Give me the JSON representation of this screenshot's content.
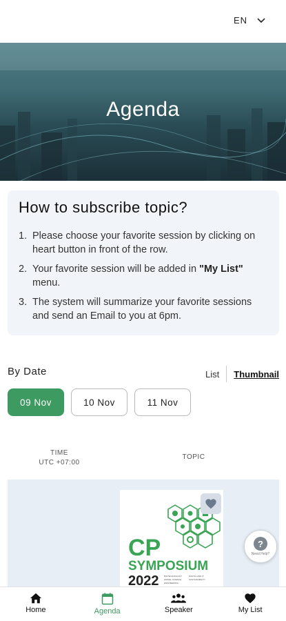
{
  "header": {
    "language": "EN",
    "language_icon": "chevron-down-icon"
  },
  "hero": {
    "title": "Agenda"
  },
  "howto": {
    "title": "How to subscribe topic?",
    "steps": [
      {
        "num": "1.",
        "text": "Please choose your favorite session by clicking on heart button in front of the row."
      },
      {
        "num": "2.",
        "text_before": "Your favorite session will be added in ",
        "bold": "\"My List\"",
        "text_after": " menu."
      },
      {
        "num": "3.",
        "text": "The system will summarize your favorite sessions and send an Email to you at 6pm."
      }
    ]
  },
  "filter": {
    "by_date_label": "By Date",
    "view_list": "List",
    "view_thumbnail": "Thumbnail",
    "active_view": "Thumbnail",
    "dates": [
      {
        "label": "09 Nov",
        "active": true
      },
      {
        "label": "10 Nov",
        "active": false
      },
      {
        "label": "11 Nov",
        "active": false
      }
    ]
  },
  "table": {
    "col_time": "TIME",
    "col_time_zone": "UTC +07:00",
    "col_topic": "TOPIC"
  },
  "session": {
    "poster": {
      "line1": "CP",
      "line2": "SYMPOSIUM",
      "line3": "2022",
      "tags": [
        "BIOTECHNOLOGY",
        "ANIMAL SCIENCE",
        "ENGINEERING",
        "DIGITAL AND IT",
        "SUSTAINABILITY"
      ]
    },
    "fav_icon": "heart-icon"
  },
  "help": {
    "label": "Need Help?",
    "icon": "question-icon"
  },
  "nav": {
    "items": [
      {
        "label": "Home",
        "icon": "home-icon",
        "active": false
      },
      {
        "label": "Agenda",
        "icon": "calendar-icon",
        "active": true
      },
      {
        "label": "Speaker",
        "icon": "people-icon",
        "active": false
      },
      {
        "label": "My List",
        "icon": "heart-icon",
        "active": false
      }
    ]
  },
  "colors": {
    "accent": "#3d9a60",
    "hero": "#3f6a73",
    "panel": "#f1f4f8"
  }
}
